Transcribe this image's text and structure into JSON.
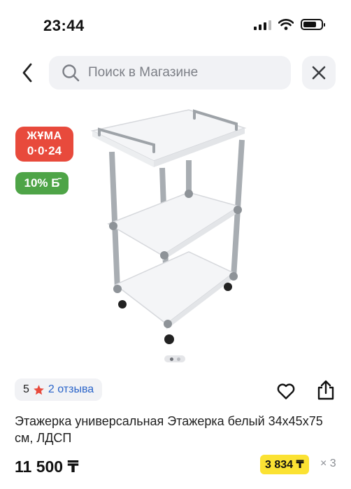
{
  "status_bar": {
    "time": "23:44",
    "icons": [
      "cellular-signal-icon",
      "wifi-icon",
      "battery-icon"
    ]
  },
  "search": {
    "placeholder": "Поиск в Магазине",
    "icons": [
      "back-arrow-icon",
      "search-icon",
      "close-icon"
    ]
  },
  "badges": {
    "juma_title": "ЖҰМА",
    "juma_timer": "0·0·24",
    "bonus": "10% Б̄"
  },
  "gallery": {
    "pages": 2,
    "active_page": 1
  },
  "rating": {
    "value": "5",
    "reviews": "2 отзыва"
  },
  "actions": [
    "heart-icon",
    "share-icon"
  ],
  "product": {
    "title": "Этажерка универсальная Этажерка белый 34x45x75 см, ЛДСП",
    "price": "11 500 ₸",
    "installment_amount": "3 834 ₸",
    "installment_count": "× 3"
  },
  "colors": {
    "accent_red": "#e84a3c",
    "bonus_green": "#4ea447",
    "installment_yellow": "#fbe233",
    "link_blue": "#2a64c9",
    "star": "#e84a3c",
    "chip_bg": "#f1f2f5"
  }
}
